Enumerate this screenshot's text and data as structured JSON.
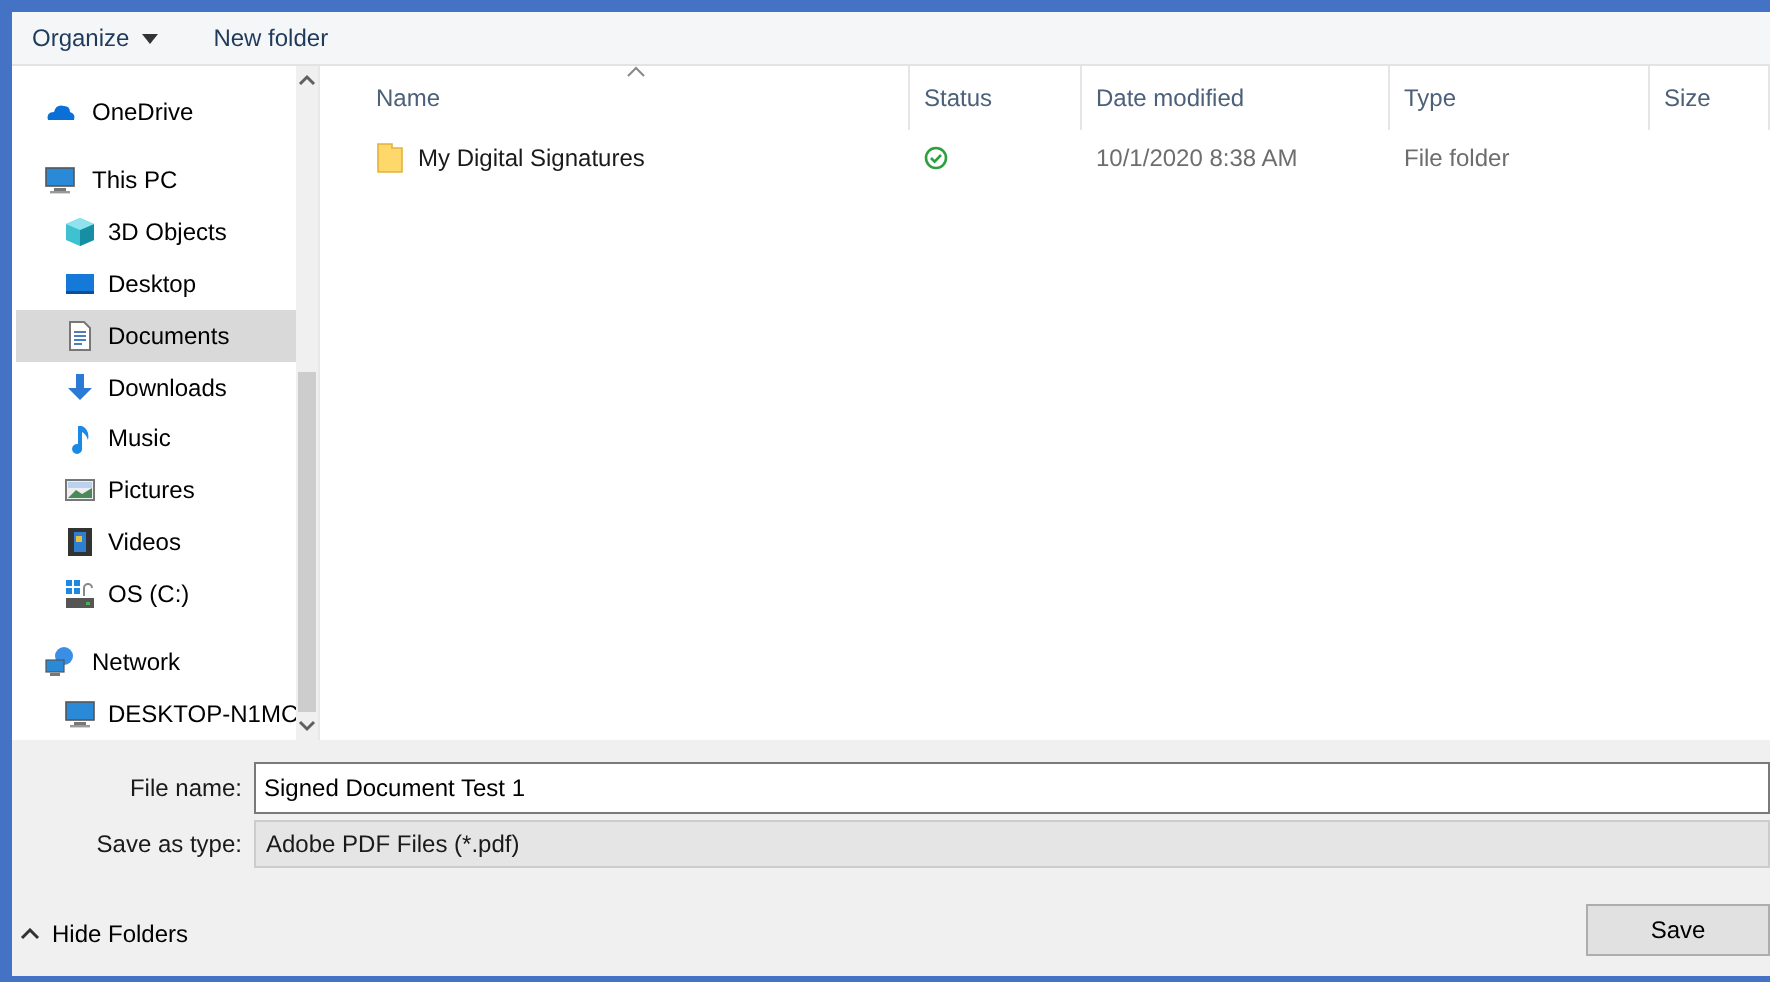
{
  "toolbar": {
    "organize": "Organize",
    "new_folder": "New folder"
  },
  "nav": [
    {
      "label": "OneDrive",
      "kind": "cloud",
      "selected": false
    },
    {
      "label": "This PC",
      "kind": "computer",
      "selected": false,
      "children": [
        {
          "label": "3D Objects",
          "kind": "cube",
          "selected": false
        },
        {
          "label": "Desktop",
          "kind": "desktop",
          "selected": false
        },
        {
          "label": "Documents",
          "kind": "document",
          "selected": true
        },
        {
          "label": "Downloads",
          "kind": "download",
          "selected": false
        },
        {
          "label": "Music",
          "kind": "music",
          "selected": false
        },
        {
          "label": "Pictures",
          "kind": "picture",
          "selected": false
        },
        {
          "label": "Videos",
          "kind": "video",
          "selected": false
        },
        {
          "label": "OS (C:)",
          "kind": "drive",
          "selected": false
        }
      ]
    },
    {
      "label": "Network",
      "kind": "network",
      "selected": false,
      "children": [
        {
          "label": "DESKTOP-N1MC",
          "kind": "computer",
          "selected": false
        }
      ]
    }
  ],
  "columns": [
    {
      "label": "Name",
      "sorted": true
    },
    {
      "label": "Status",
      "sorted": false
    },
    {
      "label": "Date modified",
      "sorted": false
    },
    {
      "label": "Type",
      "sorted": false
    },
    {
      "label": "Size",
      "sorted": false
    }
  ],
  "rows": [
    {
      "name": "My Digital Signatures",
      "synced": true,
      "date_modified": "10/1/2020 8:38 AM",
      "type": "File folder",
      "selected": false
    }
  ],
  "file_name": {
    "label": "File name:",
    "value": "Signed Document Test 1"
  },
  "save_as_type": {
    "label": "Save as type:",
    "value": "Adobe PDF Files (*.pdf)"
  },
  "hide_folders": "Hide Folders",
  "save_button": "Save"
}
